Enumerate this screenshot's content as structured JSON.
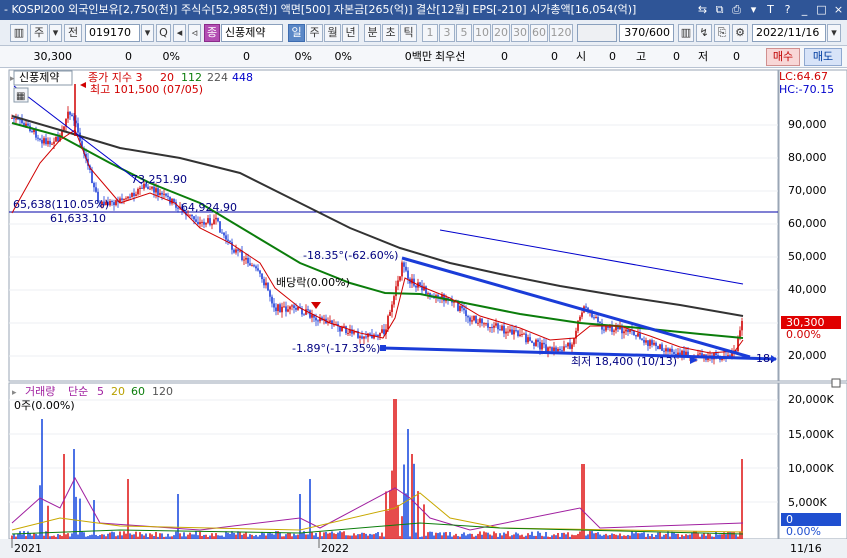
{
  "titlebar": {
    "text": "- KOSPI200 외국인보유[2,750(천)] 주식수[52,985(천)] 액면[500] 자본금[265(억)] 결산[12월] EPS[-210] 시가총액[16,054(억)]",
    "buttons": [
      "⇆",
      "⧉",
      "⎙",
      "▾",
      "T",
      "?",
      "_",
      "□",
      "×"
    ]
  },
  "toolbar": {
    "buttons_left": [
      "▥",
      "주",
      "▾",
      "전"
    ],
    "code": "019170",
    "code_buttons": [
      "▾",
      "Q",
      "◂",
      "◃"
    ],
    "name_tag": "종",
    "stock_name": "신풍제약",
    "periods": [
      "일",
      "주",
      "월",
      "년",
      "분",
      "초",
      "틱"
    ],
    "selected_period": "일",
    "intervals": [
      "1",
      "3",
      "5",
      "10",
      "20",
      "30",
      "60",
      "120"
    ],
    "count": "370/600",
    "icons": [
      "▥",
      "↯",
      "⎘",
      "⚙"
    ],
    "date": "2022/11/16"
  },
  "quote_row": {
    "price": "30,300",
    "change": "0",
    "change_pct": "0%",
    "f1": "0",
    "f2": "0%",
    "f3": "0%",
    "volume": "0백만",
    "best_ask_label": "최우선",
    "ask": "0",
    "bid": "0",
    "open_label": "시",
    "open": "0",
    "high_label": "고",
    "high": "0",
    "low_label": "저",
    "low": "0",
    "buy_label": "매수",
    "sell_label": "매도"
  },
  "price_panel": {
    "legend_name": "신풍제약",
    "legend_ma_title": "종가 지수 3",
    "legend_ma_values": [
      "20",
      "112",
      "224",
      "448"
    ],
    "legend_colors": [
      "#d00000",
      "#0b7d0b",
      "#555555",
      "#0000cc"
    ],
    "lc_label": "LC:64.67",
    "hc_label": "HC:-70.15",
    "high_marker": "최고 101,500 (07/05)",
    "low_marker": "최저 18,400 (10/13)",
    "low_marker_tail": "18,",
    "annotations": [
      "73,251.90",
      "64,924.90",
      "65,638(110.05%)",
      "61,633.10",
      "-18.35°(-62.60%)",
      "배당락(0.00%)",
      "-1.89°(-17.35%)"
    ],
    "y_ticks": [
      "90,000",
      "80,000",
      "70,000",
      "60,000",
      "50,000",
      "40,000",
      "30,000",
      "20,000"
    ],
    "current_price_tag": "30,300",
    "current_pct_tag": "0.00%"
  },
  "volume_panel": {
    "legend_title": "거래량",
    "legend_ma_label": "단순",
    "legend_ma_values": [
      "5",
      "20",
      "60",
      "120"
    ],
    "legend_colors": [
      "#a020a0",
      "#b8a000",
      "#0b7d0b",
      "#555555"
    ],
    "sub_label": "0주(0.00%)",
    "y_ticks": [
      "20,000K",
      "15,000K",
      "10,000K",
      "5,000K"
    ],
    "current_tag": "0",
    "current_pct_tag": "0.00%"
  },
  "x_axis": {
    "labels": [
      "2021",
      "2022"
    ],
    "right_date": "11/16"
  },
  "colors": {
    "titlebar": "#2f5597",
    "accent": "#5a87c6",
    "price_up": "#d00000",
    "trendline": "#0000cc",
    "ma_green": "#0b7d0b",
    "ma_gray": "#555555"
  }
}
